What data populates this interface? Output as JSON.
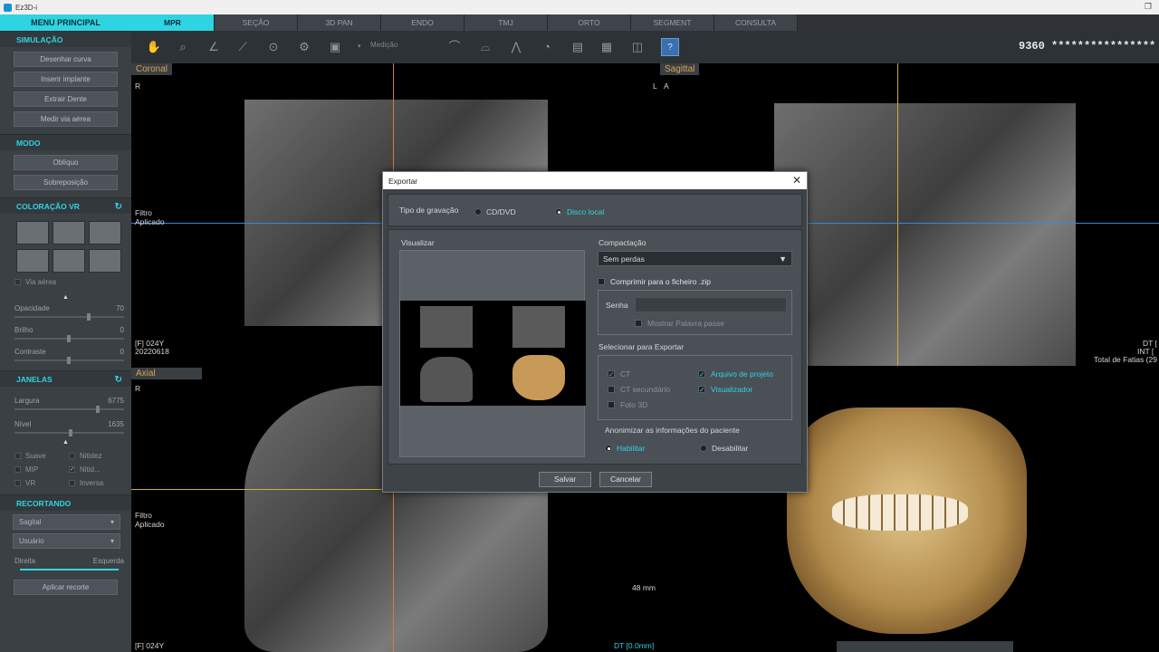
{
  "window": {
    "title": "Ez3D-i"
  },
  "sidebar": {
    "menu_title": "MENU PRINCIPAL",
    "simulacao": {
      "title": "SIMULAÇÃO",
      "buttons": [
        "Desenhar curva",
        "Inserir implante",
        "Extrair Dente",
        "Medir via aérea"
      ]
    },
    "modo": {
      "title": "MODO",
      "buttons": [
        "Oblíquo",
        "Sobreposição"
      ]
    },
    "coloracao": {
      "title": "COLORAÇÃO VR",
      "via_aerea": "Via aérea",
      "opacidade_label": "Opacidade",
      "opacidade_value": "70",
      "brilho_label": "Brilho",
      "brilho_value": "0",
      "contraste_label": "Contraste",
      "contraste_value": "0"
    },
    "janelas": {
      "title": "JANELAS",
      "largura_label": "Largura",
      "largura_value": "6775",
      "nivel_label": "Nível",
      "nivel_value": "1635",
      "checks": [
        "Suave",
        "Nitidez",
        "MIP",
        "Nitid...",
        "VR",
        "Inversa"
      ]
    },
    "recortando": {
      "title": "RECORTANDO",
      "select1": "Sagital",
      "select2": "Usuário",
      "direita": "Direita",
      "esquerda": "Esquerda",
      "apply": "Aplicar recorte"
    }
  },
  "tabs": [
    "MPR",
    "SEÇÃO",
    "3D PAN",
    "ENDO",
    "TMJ",
    "ORTO",
    "SEGMENT",
    "CONSULTA"
  ],
  "toolbar": {
    "medicao": "Medição",
    "help": "?",
    "patient": "9360 ****************"
  },
  "viewports": {
    "coronal": {
      "label": "Coronal",
      "left_marker": "R",
      "right_marker": "L",
      "filter": "Filtro\nAplicado",
      "info1": "[F] 024Y",
      "info2": "20220618"
    },
    "sagittal": {
      "label": "Sagittal",
      "left_marker": "A",
      "dt": "DT [",
      "int": "INT [",
      "total": "Total de Fatias (29"
    },
    "axial": {
      "label": "Axial",
      "left_marker": "R",
      "filter": "Filtro\nAplicado",
      "info1": "[F] 024Y",
      "scale": "48 mm",
      "dt": "DT [0.0mm]"
    }
  },
  "dialog": {
    "title": "Exportar",
    "tipo_label": "Tipo de gravação",
    "cd_dvd": "CD/DVD",
    "disco_local": "Disco local",
    "visualizar": "Visualizar",
    "compactacao_label": "Compactação",
    "compactacao_value": "Sem perdas",
    "zip_label": "Comprimir para o ficheiro .zip",
    "senha_label": "Senha",
    "mostrar_senha": "Mostrar Palavra passe",
    "selecionar_label": "Selecionar para Exportar",
    "ct": "CT",
    "ct_secundario": "CT secundário",
    "foto3d": "Foto 3D",
    "arquivo_projeto": "Arquivo de projeto",
    "visualizador": "Visualizador",
    "anonimizar_label": "Anonimizar as informações do paciente",
    "habilitar": "Habilitar",
    "desabilitar": "Desabilitar",
    "salvar": "Salvar",
    "cancelar": "Cancelar"
  }
}
